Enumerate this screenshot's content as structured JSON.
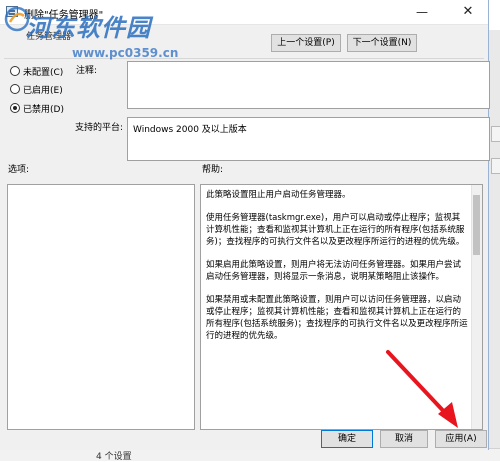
{
  "window": {
    "title": "删除\"任务管理器\""
  },
  "header": {
    "setting_name": "任务管理器"
  },
  "nav": {
    "prev_label": "上一个设置(P)",
    "next_label": "下一个设置(N)"
  },
  "state_options": [
    {
      "label": "未配置(C)",
      "selected": false
    },
    {
      "label": "已启用(E)",
      "selected": false
    },
    {
      "label": "已禁用(D)",
      "selected": true
    }
  ],
  "comment": {
    "label": "注释:",
    "value": ""
  },
  "platform": {
    "label": "支持的平台:",
    "value": "Windows 2000 及以上版本"
  },
  "options": {
    "label": "选项:"
  },
  "help": {
    "label": "帮助:",
    "paragraphs": [
      "此策略设置阻止用户启动任务管理器。",
      "使用任务管理器(taskmgr.exe)，用户可以启动或停止程序；监视其计算机性能；查看和监视其计算机上正在运行的所有程序(包括系统服务)；查找程序的可执行文件名以及更改程序所运行的进程的优先级。",
      "如果启用此策略设置，则用户将无法访问任务管理器。如果用户尝试启动任务管理器，则将显示一条消息，说明某策略阻止该操作。",
      "如果禁用或未配置此策略设置，则用户可以访问任务管理器，以启动或停止程序；监视其计算机性能；查看和监视其计算机上正在运行的所有程序(包括系统服务)；查找程序的可执行文件名以及更改程序所运行的进程的优先级。"
    ]
  },
  "buttons": {
    "ok": "确定",
    "cancel": "取消",
    "apply": "应用(A)"
  },
  "background": {
    "status_text": "4 个设置"
  },
  "watermark": {
    "title": "河东软件园",
    "url": "www.pc0359.cn"
  },
  "colors": {
    "accent": "#0078d7",
    "arrow": "#e8141e",
    "watermark": "#2a6fc1"
  }
}
